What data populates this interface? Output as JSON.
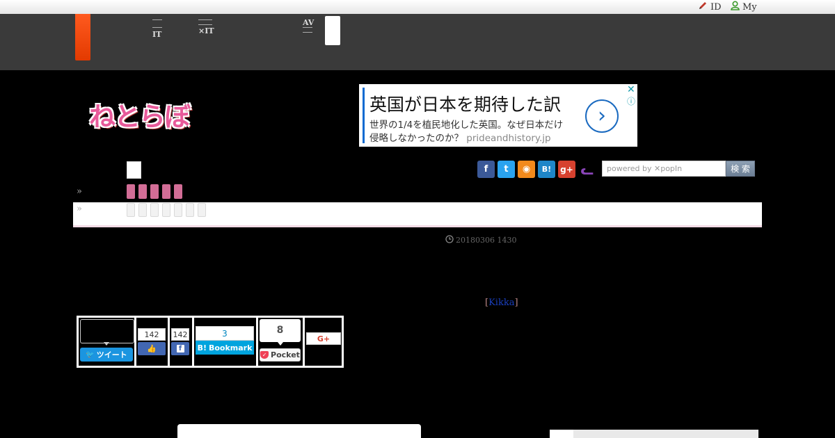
{
  "utility_bar": {
    "id_link": "ID",
    "my_link": "My"
  },
  "nav": {
    "items": [
      {
        "line1": "",
        "line2": "IT"
      },
      {
        "line1": "",
        "line2": "×IT"
      },
      {
        "line1": "AV",
        "line2": ""
      }
    ]
  },
  "logo": {
    "text": "ねとらぼ"
  },
  "ad": {
    "headline": "英国が日本を期待した訳",
    "body": "世界の1/4を植民地化した英国。なぜ日本だけ侵略しなかったのか？",
    "domain": "prideandhistory.jp",
    "arrow": "›",
    "close": "✕",
    "info": "ⓘ"
  },
  "social_icons": [
    {
      "name": "facebook-icon",
      "glyph": "f",
      "color": "#3b5998"
    },
    {
      "name": "twitter-icon",
      "glyph": "t",
      "color": "#2aa3ef"
    },
    {
      "name": "rss-icon",
      "glyph": "◉",
      "color": "#f28a1c"
    },
    {
      "name": "hatena-icon",
      "glyph": "B!",
      "color": "#1f86c8"
    },
    {
      "name": "googleplus-icon",
      "glyph": "g+",
      "color": "#d6412f"
    },
    {
      "name": "cat-icon",
      "glyph": "ᓚ",
      "color": "#8a45b8"
    }
  ],
  "search": {
    "placeholder": "powered by ✕popIn",
    "button": "検 索"
  },
  "breadcrumb": {
    "raquo": "»"
  },
  "article": {
    "timestamp": "20180306 1430",
    "author_open": "[",
    "author": "Kikka",
    "author_close": "]"
  },
  "share": {
    "tweet_label": "ツイート",
    "like_count": "142",
    "fb_share_count": "142",
    "hatena_count": "3",
    "hatena_label": "Bookmark",
    "pocket_count": "8",
    "pocket_label": "Pocket",
    "gplus_label": "G+"
  },
  "colors": {
    "accent_orange": "#ff5a1f",
    "nav_bg": "#3a3a3a",
    "pink": "#d26d96",
    "twitter_blue": "#1b95e0",
    "facebook_blue": "#4267b2",
    "hatena_blue": "#00a4de",
    "pocket_red": "#ef4056"
  }
}
